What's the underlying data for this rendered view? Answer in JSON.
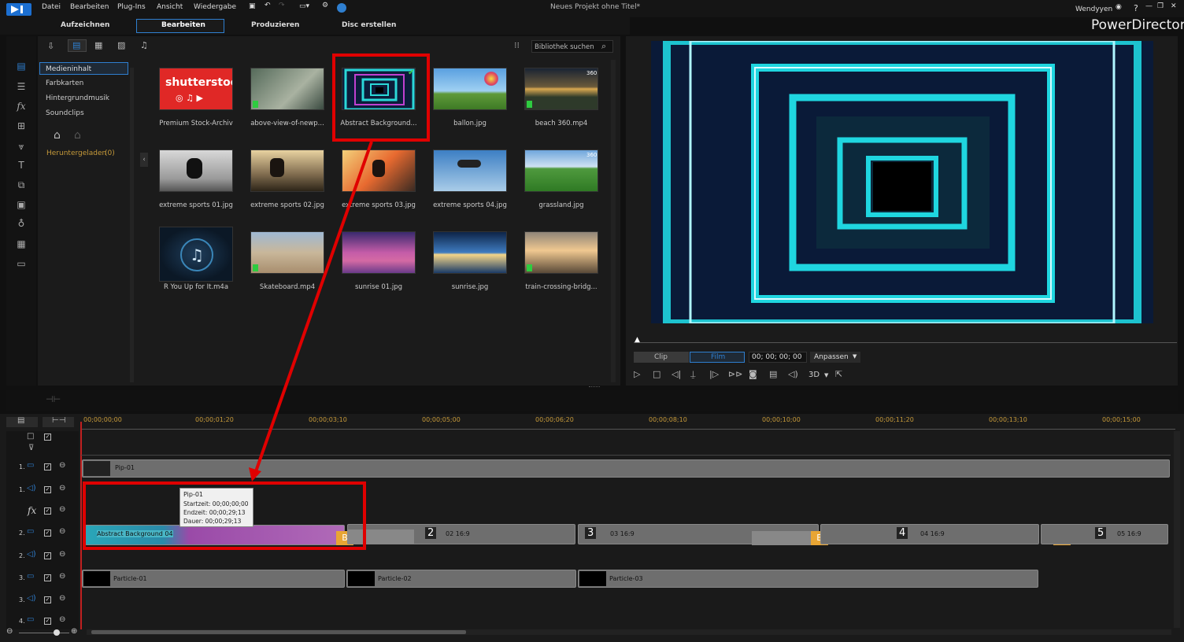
{
  "menubar": {
    "items": [
      "Datei",
      "Bearbeiten",
      "Plug-Ins",
      "Ansicht",
      "Wiedergabe"
    ],
    "title": "Neues Projekt ohne Titel*",
    "user": "Wendyyen",
    "help": "?"
  },
  "tabs": [
    "Aufzeichnen",
    "Bearbeiten",
    "Produzieren",
    "Disc erstellen"
  ],
  "app_name": "PowerDirector",
  "library": {
    "search_placeholder": "Bibliothek suchen",
    "categories": [
      "Medieninhalt",
      "Farbkarten",
      "Hintergrundmusik",
      "Soundclips"
    ],
    "downloaded": "Heruntergeladen",
    "downloaded_count": "(0)",
    "items": [
      "Premium Stock-Archiv",
      "above-view-of-newp...",
      "Abstract Background...",
      "ballon.jpg",
      "beach 360.mp4",
      "extreme sports 01.jpg",
      "extreme sports 02.jpg",
      "extreme sports 03.jpg",
      "extreme sports 04.jpg",
      "grassland.jpg",
      "R You Up for It.m4a",
      "Skateboard.mp4",
      "sunrise 01.jpg",
      "sunrise.jpg",
      "train-crossing-bridg..."
    ],
    "shutterstock": "shutterstock",
    "badge_360": "360"
  },
  "preview": {
    "clip_tab": "Clip",
    "film_tab": "Film",
    "timecode": "00; 00; 00; 00",
    "fit": "Anpassen",
    "threed": "3D"
  },
  "timeline": {
    "ruler": [
      "00;00;00;00",
      "00;00;01;20",
      "00;00;03;10",
      "00;00;05;00",
      "00;00;06;20",
      "00;00;08;10",
      "00;00;10;00",
      "00;00;11;20",
      "00;00;13;10",
      "00;00;15;00"
    ],
    "track_labels": [
      "1.",
      "1.",
      "2.",
      "2.",
      "3.",
      "3.",
      "4."
    ],
    "clips": {
      "pip1": "Pip-01",
      "abstract": "Abstract Background 04",
      "n2": "2",
      "c2": "02 16:9",
      "n3": "3",
      "c3": "03 16:9",
      "n4": "4",
      "c4": "04 16:9",
      "n5": "5",
      "c5": "05 16:9",
      "p1": "Particle-01",
      "p2": "Particle-02",
      "p3": "Particle-03",
      "b": "B"
    },
    "tooltip": {
      "title": "Pip-01",
      "start": "Startzeit: 00;00;00;00",
      "end": "Endzeit: 00;00;29;13",
      "duration": "Dauer: 00;00;29;13"
    }
  },
  "colors": {
    "accent": "#2f7fd0",
    "annotation": "#e00000",
    "neon": "#29e0e0"
  }
}
